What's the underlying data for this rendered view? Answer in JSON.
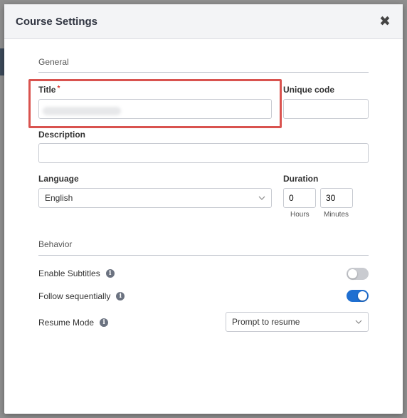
{
  "dialog": {
    "title": "Course Settings",
    "close_icon": "close-icon"
  },
  "general": {
    "section_label": "General",
    "title_label": "Title",
    "title_required_mark": "*",
    "unique_code_label": "Unique code",
    "unique_code_value": "",
    "description_label": "Description",
    "description_value": "",
    "language_label": "Language",
    "language_value": "English",
    "duration_label": "Duration",
    "hours_value": "0",
    "minutes_value": "30",
    "hours_label": "Hours",
    "minutes_label": "Minutes"
  },
  "behavior": {
    "section_label": "Behavior",
    "enable_subtitles_label": "Enable Subtitles",
    "enable_subtitles_on": false,
    "follow_sequentially_label": "Follow sequentially",
    "follow_sequentially_on": true,
    "resume_mode_label": "Resume Mode",
    "resume_mode_value": "Prompt to resume",
    "info_glyph": "i"
  },
  "colors": {
    "highlight": "#d9534f",
    "toggle_on": "#1f6fd1",
    "toggle_off": "#c9cbd0"
  }
}
